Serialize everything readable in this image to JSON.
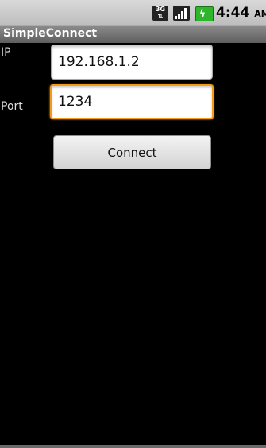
{
  "status_bar": {
    "network": "3G",
    "time": "4:44",
    "ampm": "AM",
    "icons": [
      "3g-data-icon",
      "signal-strength-icon",
      "battery-charging-icon"
    ]
  },
  "app": {
    "title": "SimpleConnect"
  },
  "form": {
    "ip_label": "IP",
    "ip_value": "192.168.1.2",
    "port_label": "Port",
    "port_value": "1234",
    "connect_label": "Connect"
  },
  "colors": {
    "focus": "#f59a17",
    "battery": "#2fb52b",
    "background": "#000000"
  }
}
